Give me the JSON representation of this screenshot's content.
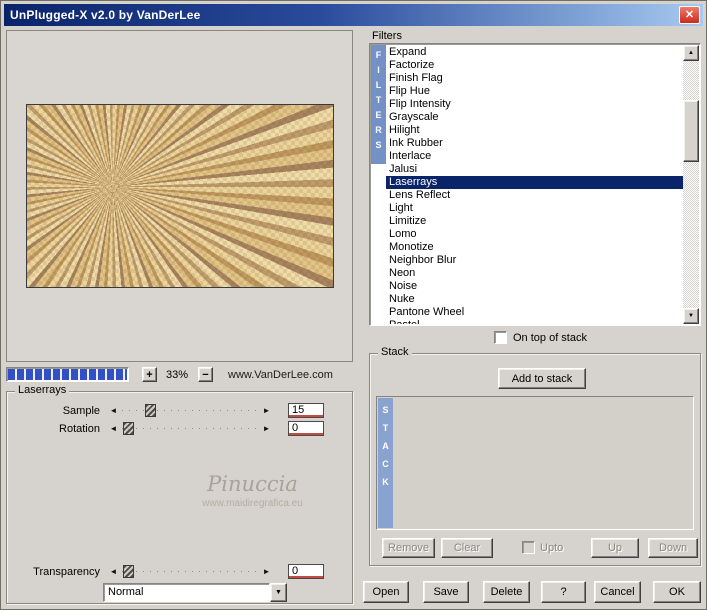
{
  "window": {
    "title": "UnPlugged-X v2.0 by VanDerLee"
  },
  "icons": {
    "close": "✕",
    "left_arrow": "◄",
    "right_arrow": "►",
    "up_arrow": "▲",
    "down_arrow": "▼"
  },
  "preview": {
    "zoom_in": "+",
    "zoom_level": "33%",
    "zoom_out": "−",
    "site": "www.VanDerLee.com"
  },
  "params": {
    "group_label": "Laserrays",
    "sample": {
      "label": "Sample",
      "value": "15"
    },
    "rotation": {
      "label": "Rotation",
      "value": "0"
    },
    "transparency": {
      "label": "Transparency",
      "value": "0"
    },
    "blend_mode": "Normal",
    "watermark_name": "Pinuccia",
    "watermark_site": "www.maidiregrafica.eu"
  },
  "filters": {
    "label": "Filters",
    "tab": "FILTERS",
    "selected": "Laserrays",
    "items": [
      "Expand",
      "Factorize",
      "Finish Flag",
      "Flip Hue",
      "Flip Intensity",
      "Grayscale",
      "Hilight",
      "Ink Rubber",
      "Interlace",
      "Jalusi",
      "Laserrays",
      "Lens Reflect",
      "Light",
      "Limitize",
      "Lomo",
      "Monotize",
      "Neighbor Blur",
      "Neon",
      "Noise",
      "Nuke",
      "Pantone Wheel",
      "Pastel"
    ],
    "on_top_label": "On top of stack"
  },
  "stack": {
    "label": "Stack",
    "tab": "STACK",
    "add_label": "Add to stack",
    "remove_label": "Remove",
    "clear_label": "Clear",
    "upto_label": "Upto",
    "up_label": "Up",
    "down_label": "Down"
  },
  "footer": {
    "open": "Open",
    "save": "Save",
    "delete": "Delete",
    "help": "?",
    "cancel": "Cancel",
    "ok": "OK"
  },
  "colors": {
    "selection": "#0a246a",
    "filters_tab_blue": "#7491c5",
    "stack_tab_blue": "#8aa2d0",
    "progress_blue": "#3150c8",
    "titlebar_from": "#0a246a",
    "titlebar_to": "#a6caf0"
  }
}
